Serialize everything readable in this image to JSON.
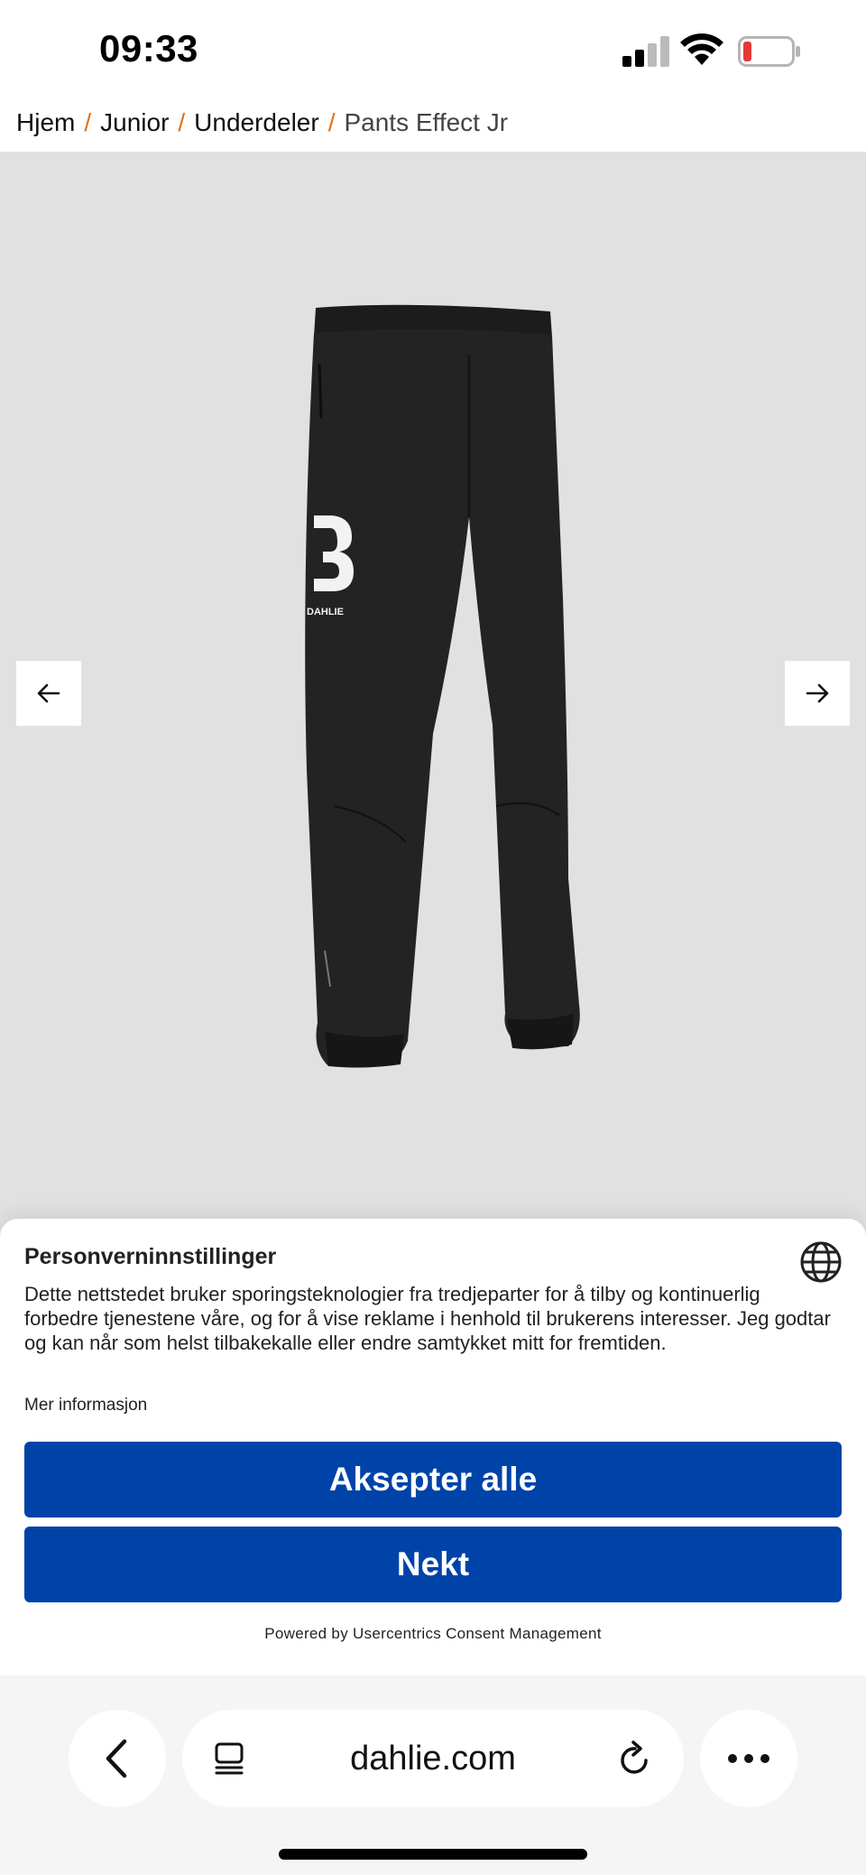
{
  "status_bar": {
    "time": "09:33",
    "icons": [
      "signal-icon",
      "wifi-icon",
      "battery-icon"
    ],
    "battery_level_color": "#e53935"
  },
  "breadcrumb": {
    "items": [
      "Hjem",
      "Junior",
      "Underdeler"
    ],
    "separator": "/",
    "current": "Pants Effect Jr",
    "separator_color": "#e07020"
  },
  "product": {
    "image_icon": "pants-image",
    "logo_text": "DAHLIE",
    "background_color": "#e1e1e1",
    "prev_icon": "arrow-left-icon",
    "next_icon": "arrow-right-icon"
  },
  "consent": {
    "title": "Personverninnstillinger",
    "text": "Dette nettstedet bruker sporingsteknologier fra tredjeparter for å tilby og kontinuerlig forbedre tjenestene våre, og for å vise reklame i henhold til brukerens interesser. Jeg godtar og kan når som helst tilbakekalle eller endre samtykket mitt for fremtiden.",
    "more_info": "Mer informasjon",
    "accept_label": "Aksepter alle",
    "deny_label": "Nekt",
    "powered_by": "Powered by Usercentrics Consent Management",
    "button_color": "#0043a8",
    "language_icon": "globe-icon"
  },
  "browser": {
    "domain": "dahlie.com",
    "back_icon": "chevron-left-icon",
    "tabs_icon": "tabs-icon",
    "reload_icon": "reload-icon",
    "more_icon": "more-icon"
  }
}
